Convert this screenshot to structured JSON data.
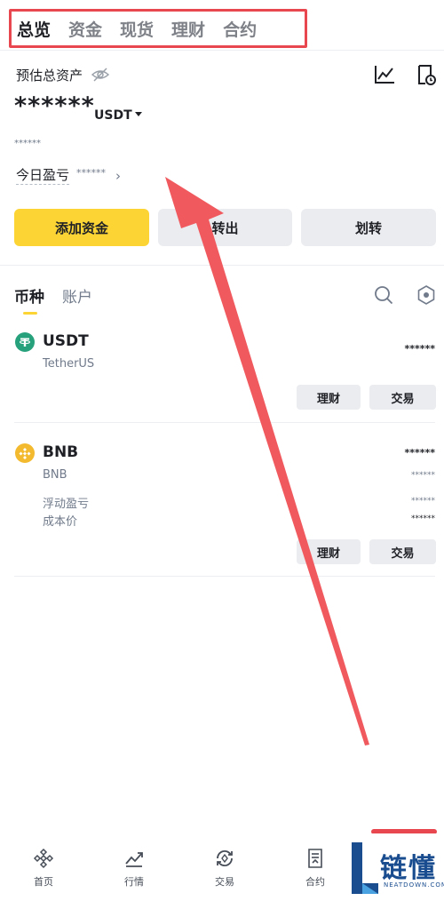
{
  "top_tabs": [
    {
      "label": "总览",
      "active": true
    },
    {
      "label": "资金",
      "active": false
    },
    {
      "label": "现货",
      "active": false
    },
    {
      "label": "理财",
      "active": false
    },
    {
      "label": "合约",
      "active": false
    }
  ],
  "overview": {
    "label": "预估总资产",
    "total_masked": "******",
    "currency": "USDT",
    "secondary_masked": "******",
    "pnl_label": "今日盈亏",
    "pnl_masked": "******",
    "pnl_chevron": "›"
  },
  "actions": {
    "deposit": "添加资金",
    "transfer_out": "转出",
    "transfer": "划转"
  },
  "section_tabs": {
    "coin": "币种",
    "account": "账户"
  },
  "coins": [
    {
      "symbol": "USDT",
      "name": "TetherUS",
      "amount": "******",
      "earn": "理财",
      "trade": "交易"
    },
    {
      "symbol": "BNB",
      "name": "BNB",
      "amount": "******",
      "sub_amount": "******",
      "pnl_label": "浮动盈亏",
      "pnl_value": "******",
      "cost_label": "成本价",
      "cost_value": "******",
      "earn": "理财",
      "trade": "交易"
    }
  ],
  "bottom_nav": [
    {
      "label": "首页",
      "icon": "home-icon"
    },
    {
      "label": "行情",
      "icon": "markets-icon"
    },
    {
      "label": "交易",
      "icon": "trade-icon"
    },
    {
      "label": "合约",
      "icon": "futures-icon"
    }
  ],
  "watermark": {
    "text": "链懂",
    "sub": "NEATDOWN.COM"
  },
  "colors": {
    "accent": "#fcd535",
    "highlight": "#e8474f",
    "text": "#1e2026",
    "muted": "#707a8a"
  }
}
